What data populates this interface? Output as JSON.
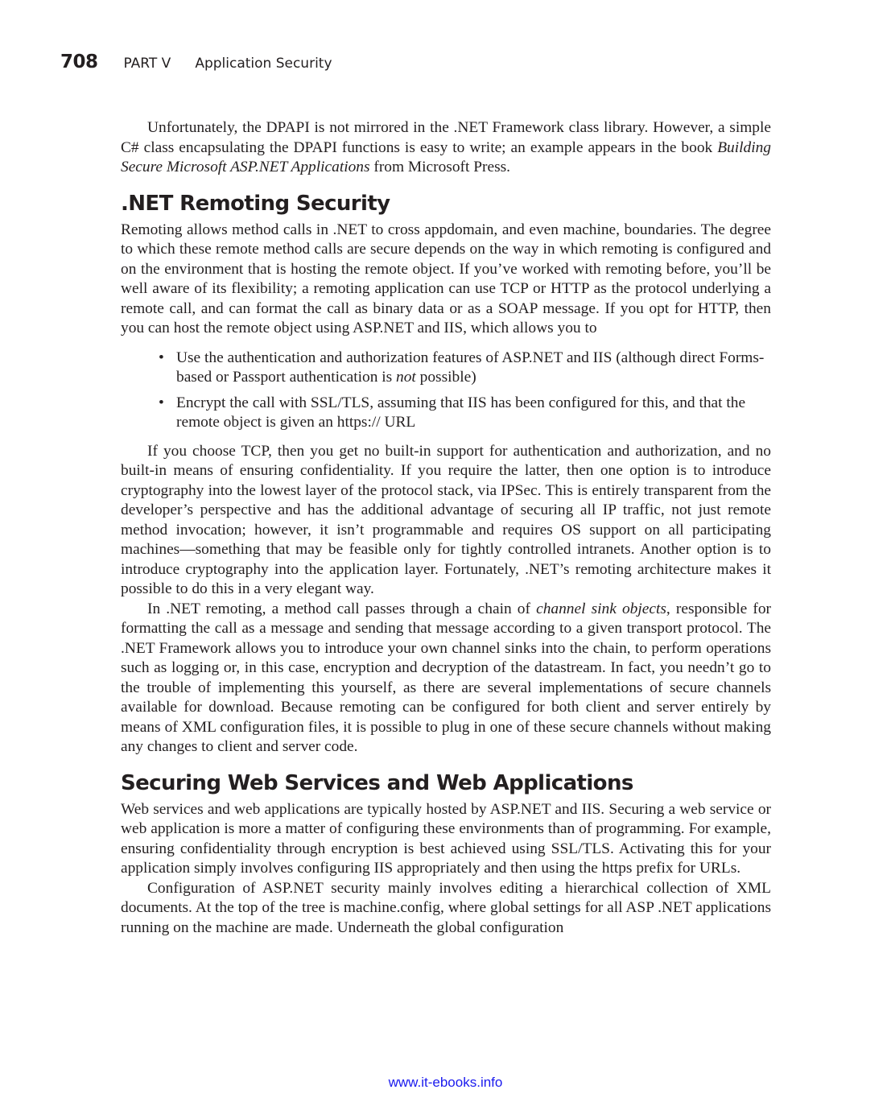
{
  "header": {
    "page_number": "708",
    "part": "PART V",
    "section": "Application Security"
  },
  "intro": {
    "p1_a": "Unfortunately, the DPAPI is not mirrored in the .NET Framework class library. However, a simple C# class encapsulating the DPAPI functions is easy to write; an example appears in the book ",
    "p1_book": "Building Secure Microsoft ASP.NET Applications",
    "p1_b": " from Microsoft Press."
  },
  "remoting": {
    "heading": ".NET Remoting Security",
    "p1": "Remoting allows method calls in .NET to cross appdomain, and even machine, boundaries. The degree to which these remote method calls are secure depends on the way in which remoting is configured and on the environment that is hosting the remote object. If you’ve worked with remoting before, you’ll be well aware of its flexibility; a remoting application can use TCP or HTTP as the protocol underlying a remote call, and can format the call as binary data or as a SOAP message. If you opt for HTTP, then you can host the remote object using ASP.NET and IIS, which allows you to",
    "bullets": {
      "b1_a": "Use the authentication and authorization features of ASP.NET and IIS (although direct Forms-based or Passport authentication is ",
      "b1_em": "not",
      "b1_b": " possible)",
      "b2": "Encrypt the call with SSL/TLS, assuming that IIS has been configured for this, and that the remote object is given an https:// URL"
    },
    "p2": "If you choose TCP, then you get no built-in support for authentication and authorization, and no built-in means of ensuring confidentiality. If you require the latter, then one option is to introduce cryptography into the lowest layer of the protocol stack, via IPSec. This is entirely transparent from the developer’s perspective and has the additional advantage of securing all IP traffic, not just remote method invocation; however, it isn’t programmable and requires OS support on all participating machines—something that may be feasible only for tightly controlled intranets. Another option is to introduce cryptography into the application layer. Fortunately, .NET’s remoting architecture makes it possible to do this in a very elegant way.",
    "p3_a": "In .NET remoting, a method call passes through a chain of ",
    "p3_em": "channel sink objects",
    "p3_b": ", responsible for formatting the call as a message and sending that message according to a given transport protocol. The .NET Framework allows you to introduce your own channel sinks into the chain, to perform operations such as logging or, in this case, encryption and decryption of the datastream. In fact, you needn’t go to the trouble of implementing this yourself, as there are several implementations of secure channels available for download. Because remoting can be configured for both client and server entirely by means of XML configuration files, it is possible to plug in one of these secure channels without making any changes to client and server code."
  },
  "webservices": {
    "heading": "Securing Web Services and Web Applications",
    "p1": "Web services and web applications are typically hosted by ASP.NET and IIS. Securing a web service or web application is more a matter of configuring these environments than of programming. For example, ensuring confidentiality through encryption is best achieved using SSL/TLS. Activating this for your application simply involves configuring IIS appropriately and then using the https prefix for URLs.",
    "p2": "Configuration of ASP.NET security mainly involves editing a hierarchical collection of XML documents. At the top of the tree is machine.config, where global settings for all ASP .NET applications running on the machine are made. Underneath the global configuration"
  },
  "footer": {
    "url": "www.it-ebooks.info"
  }
}
